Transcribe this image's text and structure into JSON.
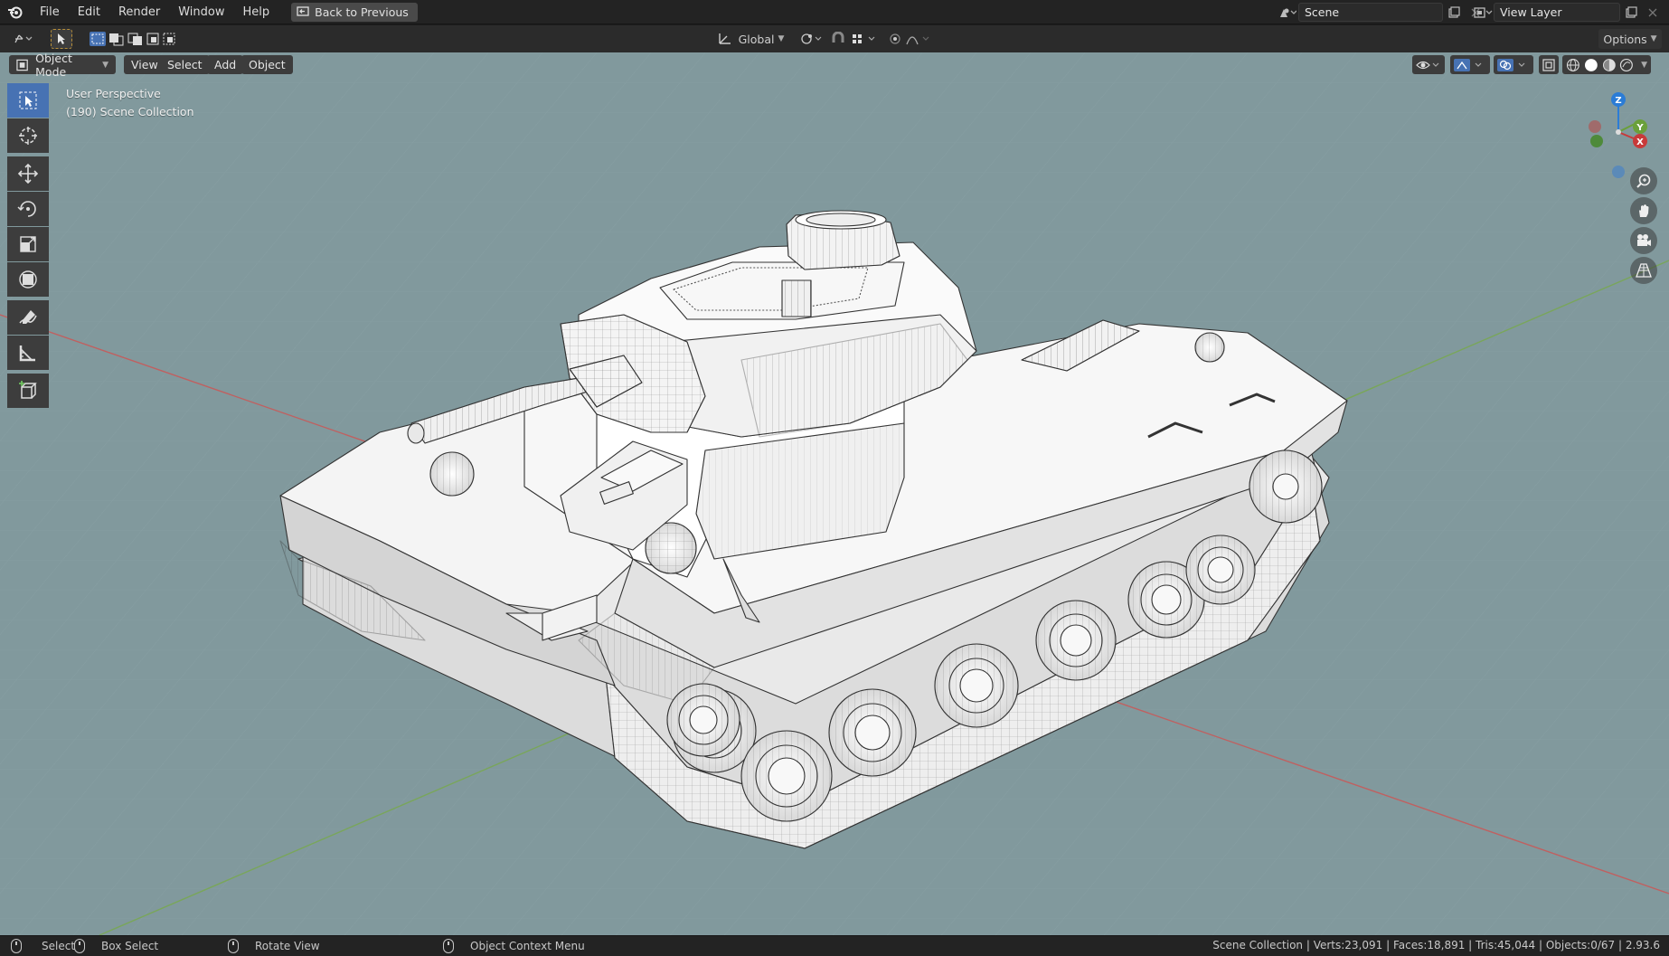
{
  "menu": {
    "items": [
      "File",
      "Edit",
      "Render",
      "Window",
      "Help"
    ],
    "back_button": "Back to Previous"
  },
  "scene": {
    "name": "Scene"
  },
  "view_layer": {
    "name": "View Layer"
  },
  "tool_header": {
    "transform_orientation": "Global",
    "options_label": "Options"
  },
  "viewport_header": {
    "mode": "Object Mode",
    "menus": [
      "View",
      "Select",
      "Add",
      "Object"
    ]
  },
  "viewport": {
    "perspective_label": "User Perspective",
    "collection_label": "(190) Scene Collection",
    "gizmo": {
      "x": "X",
      "y": "Y",
      "z": "Z"
    }
  },
  "toolbar": {
    "tools": [
      "select-box",
      "cursor",
      "move",
      "rotate",
      "scale",
      "transform",
      "annotate",
      "measure",
      "add-cube"
    ]
  },
  "statusbar": {
    "select": "Select",
    "box_select": "Box Select",
    "rotate_view": "Rotate View",
    "context_menu": "Object Context Menu",
    "stats": "Scene Collection | Verts:23,091 | Faces:18,891 | Tris:45,044 | Objects:0/67 | 2.93.6"
  },
  "colors": {
    "viewport_bg": "#81999d",
    "accent": "#4772b3",
    "axis_x": "#c83a3a",
    "axis_y": "#6aa03a",
    "axis_z": "#2b7cd6"
  }
}
